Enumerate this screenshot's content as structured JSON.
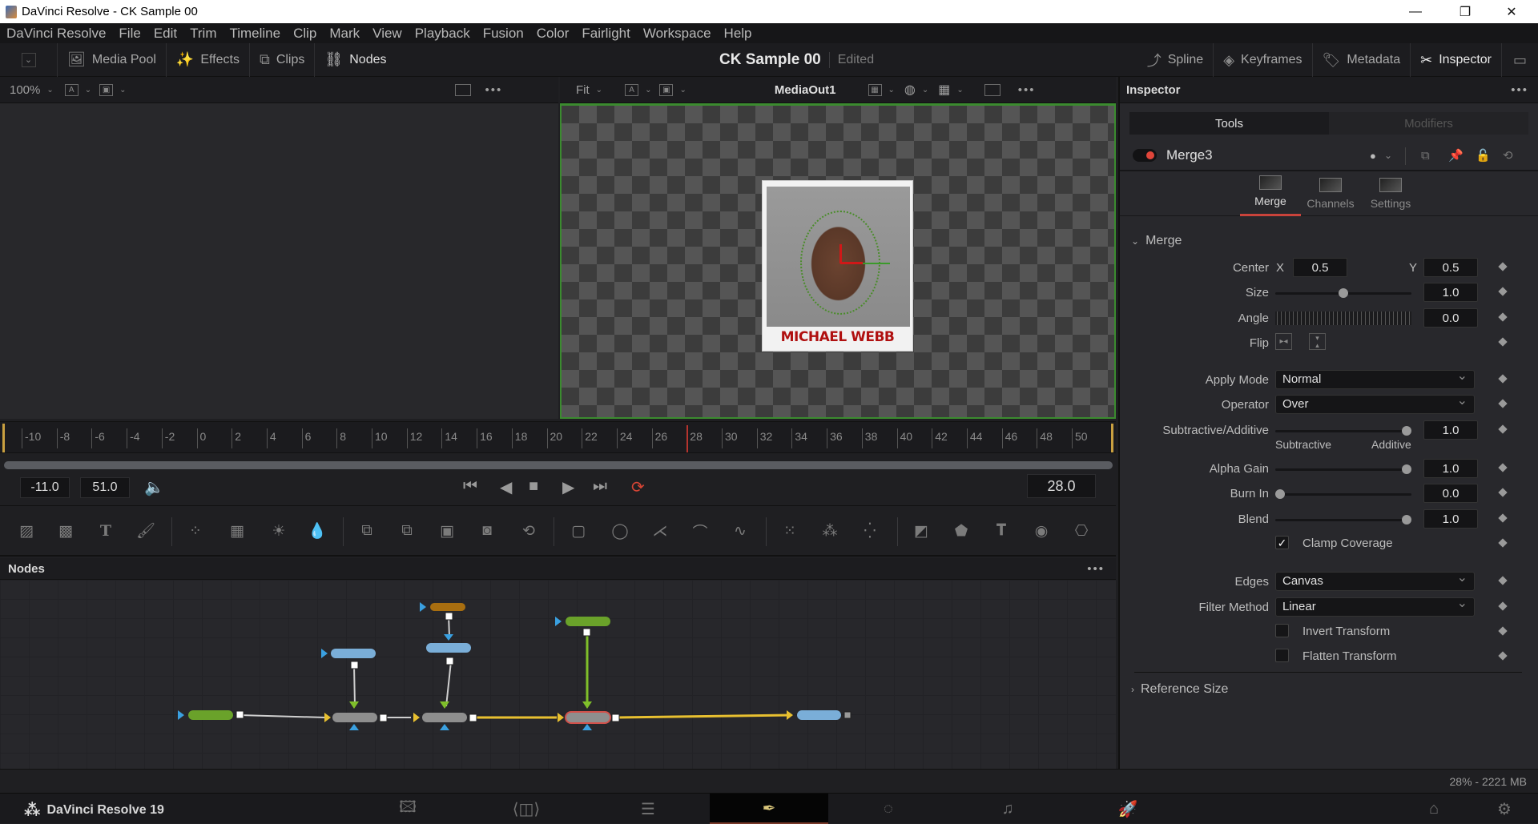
{
  "window": {
    "title": "DaVinci Resolve - CK Sample 00",
    "controls": {
      "minimize": "—",
      "maximize": "❐",
      "close": "✕"
    }
  },
  "menu": [
    "DaVinci Resolve",
    "File",
    "Edit",
    "Trim",
    "Timeline",
    "Clip",
    "Mark",
    "View",
    "Playback",
    "Fusion",
    "Color",
    "Fairlight",
    "Workspace",
    "Help"
  ],
  "toolbar": {
    "left": [
      {
        "label": "Media Pool",
        "icon": "media-pool-icon"
      },
      {
        "label": "Effects",
        "icon": "effects-wand-icon"
      },
      {
        "label": "Clips",
        "icon": "clips-icon"
      },
      {
        "label": "Nodes",
        "icon": "nodes-icon"
      }
    ],
    "project_name": "CK Sample 00",
    "project_state": "Edited",
    "right": [
      {
        "label": "Spline",
        "icon": "spline-icon"
      },
      {
        "label": "Keyframes",
        "icon": "keyframes-icon"
      },
      {
        "label": "Metadata",
        "icon": "metadata-icon"
      },
      {
        "label": "Inspector",
        "icon": "inspector-icon"
      }
    ]
  },
  "viewer_left": {
    "zoom": "100%",
    "chip_a": "A"
  },
  "viewer_right": {
    "fit": "Fit",
    "chip_a": "A",
    "title": "MediaOut1"
  },
  "image": {
    "caption": "MICHAEL WEBB"
  },
  "timeline": {
    "ticks": [
      "-10",
      "-8",
      "-6",
      "-4",
      "-2",
      "0",
      "2",
      "4",
      "6",
      "8",
      "10",
      "12",
      "14",
      "16",
      "18",
      "20",
      "22",
      "24",
      "26",
      "28",
      "30",
      "32",
      "34",
      "36",
      "38",
      "40",
      "42",
      "44",
      "46",
      "48",
      "50"
    ],
    "playhead": 28,
    "range_start": "-11.0",
    "range_end": "51.0",
    "current_frame": "28.0"
  },
  "nodes_panel": {
    "title": "Nodes",
    "menu": "•••"
  },
  "inspector": {
    "title": "Inspector",
    "menu": "•••",
    "tabs": [
      {
        "label": "Tools",
        "active": true
      },
      {
        "label": "Modifiers",
        "active": false
      }
    ],
    "node_name": "Merge3",
    "subtabs": [
      {
        "label": "Merge",
        "active": true
      },
      {
        "label": "Channels",
        "active": false
      },
      {
        "label": "Settings",
        "active": false
      }
    ],
    "section": "Merge",
    "center": {
      "label": "Center",
      "x_label": "X",
      "x": "0.5",
      "y_label": "Y",
      "y": "0.5"
    },
    "size": {
      "label": "Size",
      "value": "1.0",
      "slider": 0.5
    },
    "angle": {
      "label": "Angle",
      "value": "0.0"
    },
    "flip": {
      "label": "Flip"
    },
    "apply_mode": {
      "label": "Apply Mode",
      "value": "Normal"
    },
    "operator": {
      "label": "Operator",
      "value": "Over"
    },
    "sub_add": {
      "label": "Subtractive/Additive",
      "value": "1.0",
      "left": "Subtractive",
      "right": "Additive",
      "slider": 1.0
    },
    "alpha_gain": {
      "label": "Alpha Gain",
      "value": "1.0",
      "slider": 1.0
    },
    "burn_in": {
      "label": "Burn In",
      "value": "0.0",
      "slider": 0.0
    },
    "blend": {
      "label": "Blend",
      "value": "1.0",
      "slider": 1.0
    },
    "clamp": {
      "label": "Clamp Coverage",
      "checked": true
    },
    "edges": {
      "label": "Edges",
      "value": "Canvas"
    },
    "filter": {
      "label": "Filter Method",
      "value": "Linear"
    },
    "invert": {
      "label": "Invert Transform",
      "checked": false
    },
    "flatten": {
      "label": "Flatten Transform",
      "checked": false
    },
    "reference_size": "Reference Size"
  },
  "status": {
    "memory": "28% - 2221 MB"
  },
  "pagebar": {
    "brand": "DaVinci Resolve 19",
    "pages": [
      "media",
      "cut",
      "edit",
      "fusion",
      "color",
      "fairlight",
      "deliver"
    ],
    "active": "fusion"
  },
  "colors": {
    "accent_red": "#c9433b",
    "viewer_border": "#3b8b2f",
    "link_yellow": "#e8c030",
    "node_green": "#6aa22a",
    "node_blue": "#7aaed8",
    "node_gray": "#8e8e8e",
    "node_orange": "#a86e10"
  }
}
